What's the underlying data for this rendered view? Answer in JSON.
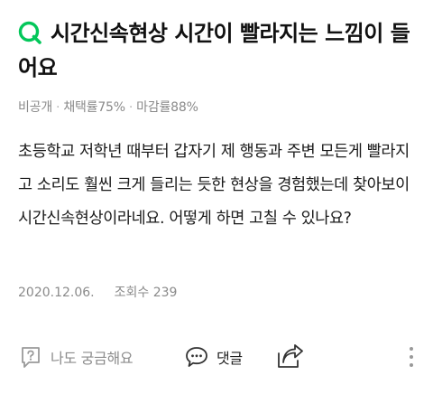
{
  "question": {
    "title": "시간신속현상 시간이 빨라지는 느낌이 들어요",
    "meta": {
      "visibility": "비공개",
      "adoption_rate": "채택률75%",
      "deadline_rate": "마감률88%"
    },
    "body": "초등학교 저학년 때부터 갑자기 제 행동과 주변 모든게 빨라지고 소리도 훨씬 크게 들리는 듯한 현상을 경험했는데 찾아보이 시간신속현상이라네요. 어떻게 하면 고칠 수 있나요?",
    "date": "2020.12.06.",
    "views": "조회수 239"
  },
  "actions": {
    "curious_label": "나도 궁금해요",
    "comment_label": "댓글"
  },
  "colors": {
    "brand_green": "#03c75a",
    "meta_gray": "#8a8a8a"
  },
  "icons": {
    "q": "q-logo-icon",
    "curious": "question-speech-icon",
    "comment": "comment-bubble-icon",
    "share": "share-icon",
    "more": "more-vertical-icon"
  }
}
